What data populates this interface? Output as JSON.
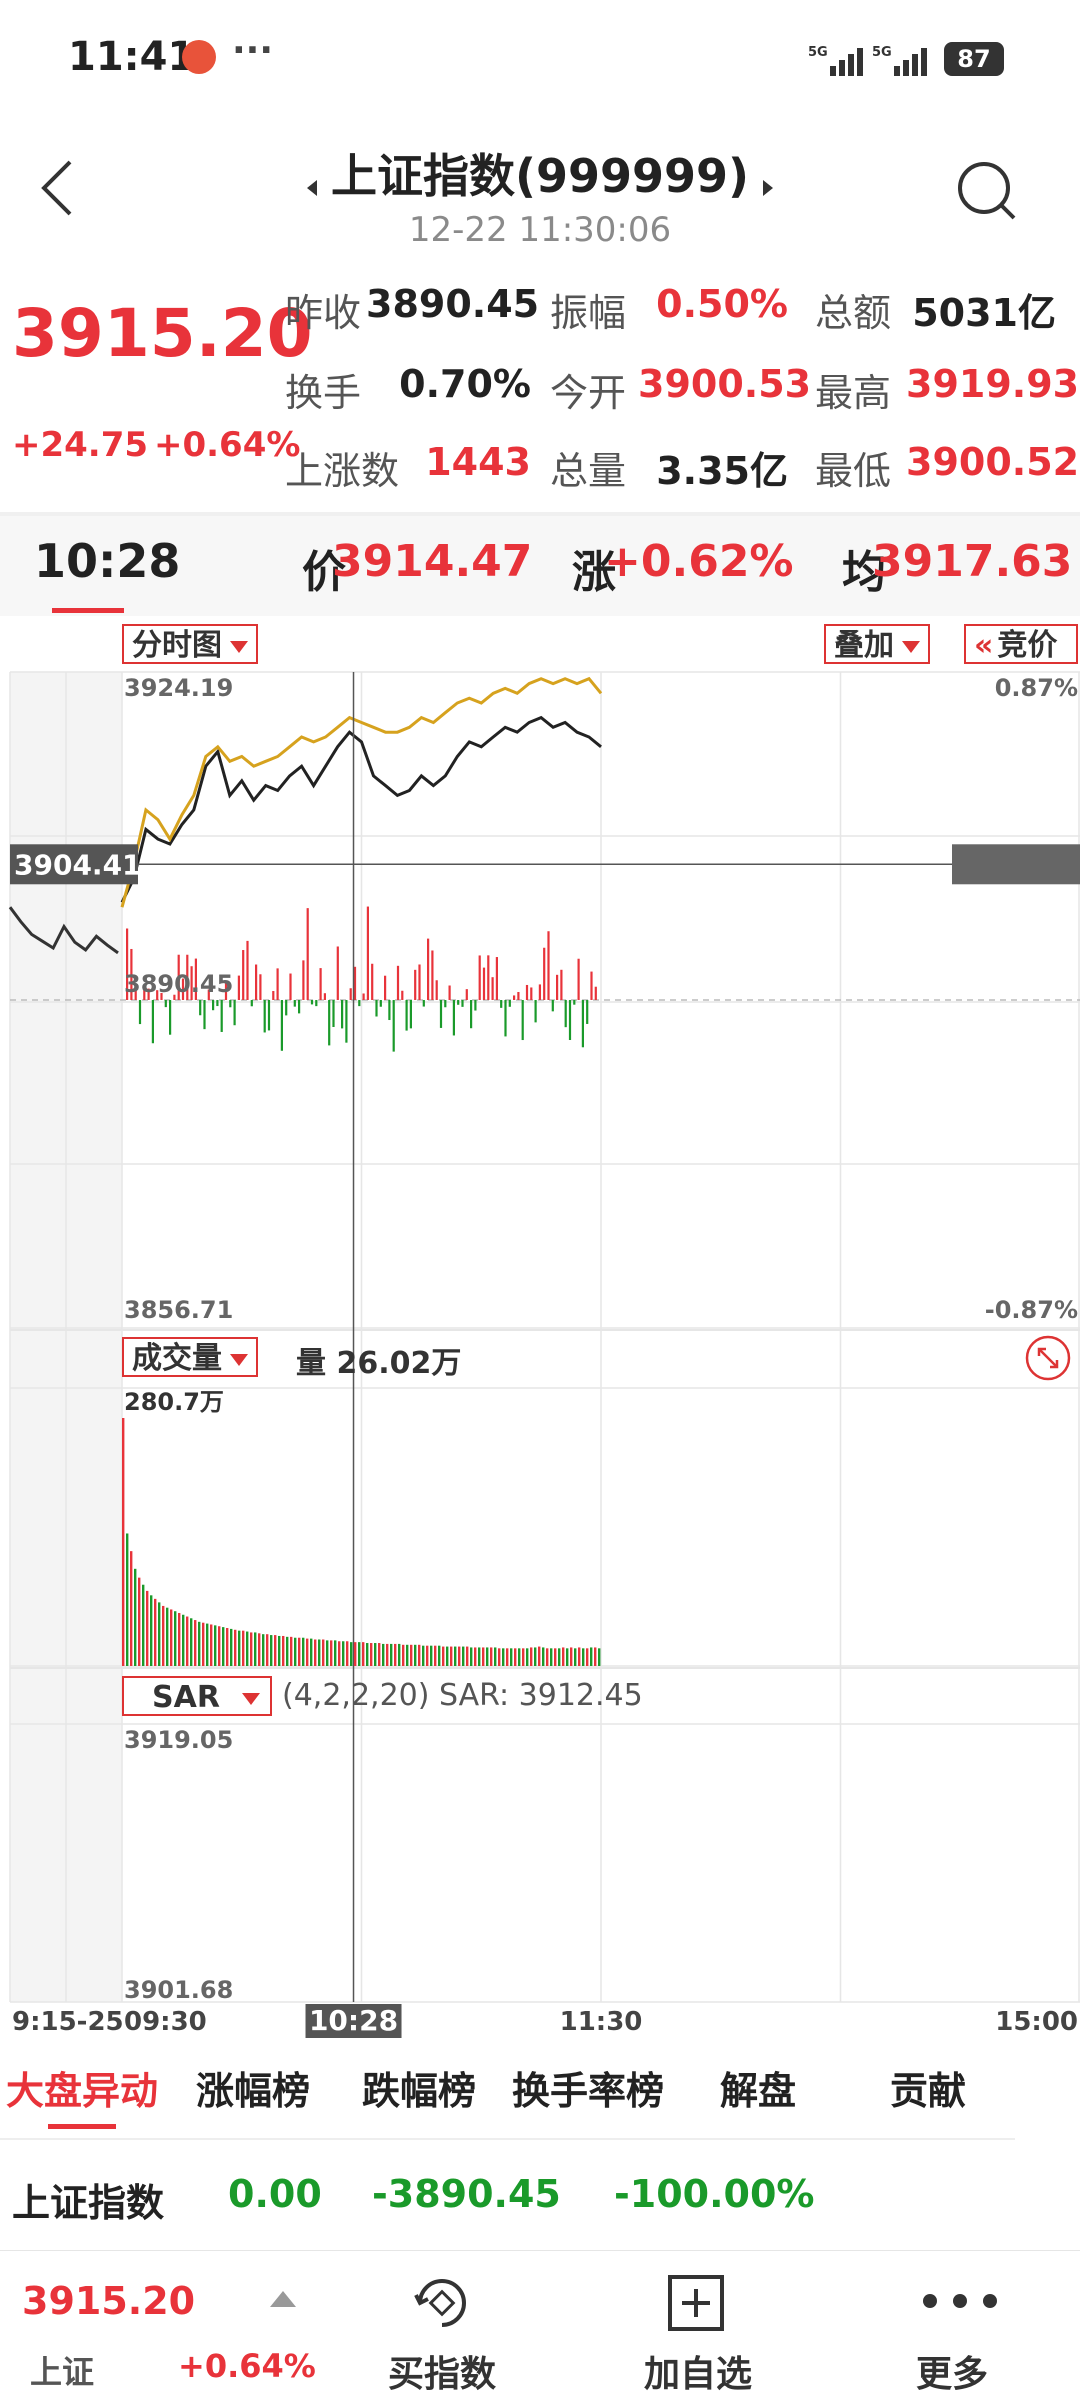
{
  "status": {
    "time": "11:41",
    "dots": "···",
    "net1": "5G",
    "net2": "5G",
    "battery": "87"
  },
  "header": {
    "title": "上证指数(999999)",
    "datetime": "12-22 11:30:06"
  },
  "quote": {
    "price": "3915.20",
    "change": "+24.75",
    "change_pct": "+0.64%",
    "rows": [
      [
        {
          "label": "昨收",
          "value": "3890.45",
          "color": "dark"
        },
        {
          "label": "振幅",
          "value": "0.50%",
          "color": "red"
        },
        {
          "label": "总额",
          "value": "5031亿",
          "color": "dark"
        }
      ],
      [
        {
          "label": "换手",
          "value": "0.70%",
          "color": "dark"
        },
        {
          "label": "今开",
          "value": "3900.53",
          "color": "red"
        },
        {
          "label": "最高",
          "value": "3919.93",
          "color": "red"
        }
      ],
      [
        {
          "label": "上涨数",
          "value": "1443",
          "color": "red"
        },
        {
          "label": "总量",
          "value": "3.35亿",
          "color": "dark"
        },
        {
          "label": "最低",
          "value": "3900.52",
          "color": "red"
        }
      ]
    ]
  },
  "crosshair_bar": {
    "time": "10:28",
    "price_label": "价",
    "price": "3914.47",
    "change_label": "涨",
    "change": "+0.62%",
    "avg_label": "均",
    "avg": "3917.63"
  },
  "chart_controls": {
    "fenshi": "分时图",
    "overlay": "叠加",
    "bidding": "竞价",
    "volume_indicator": "成交量",
    "volume_text": "量 26.02万",
    "sar": "SAR",
    "sar_params": "(4,2,2,20) SAR: 3912.45"
  },
  "chart_data": [
    {
      "type": "line",
      "title": "",
      "y_top_label": "3924.19",
      "y_bottom_label": "3856.71",
      "pct_top_label": "0.87%",
      "pct_bottom_label": "-0.87%",
      "prev_close_label": "3890.45",
      "crosshair_value_label": "3904.41",
      "ylim": [
        3856.71,
        3924.19
      ],
      "xlim_minutes": [
        0,
        240
      ],
      "x_ticks": [
        "9:15-25",
        "09:30",
        "10:28",
        "11:30",
        "15:00"
      ],
      "pre_market": [
        3900.0,
        3898.5,
        3897.2,
        3896.5,
        3895.8,
        3898.0,
        3896.4,
        3895.6,
        3897.0,
        3896.1,
        3895.3
      ],
      "series": [
        {
          "color": "#222222",
          "x": [
            0,
            3,
            6,
            9,
            12,
            15,
            18,
            21,
            24,
            27,
            30,
            33,
            36,
            39,
            42,
            45,
            48,
            51,
            54,
            57,
            60,
            63,
            66,
            69,
            72,
            75,
            78,
            81,
            84,
            87,
            90,
            93,
            96,
            99,
            102,
            105,
            108,
            111,
            114,
            117,
            120
          ],
          "values": [
            3900.5,
            3903.0,
            3908.0,
            3907.0,
            3906.5,
            3908.5,
            3910.0,
            3914.5,
            3916.0,
            3911.5,
            3913.0,
            3911.0,
            3912.5,
            3912.0,
            3913.5,
            3914.5,
            3912.5,
            3914.5,
            3916.5,
            3918.0,
            3917.0,
            3913.5,
            3912.5,
            3911.5,
            3912.0,
            3913.5,
            3912.5,
            3913.5,
            3915.5,
            3917.0,
            3916.5,
            3917.5,
            3918.5,
            3918.0,
            3919.0,
            3919.5,
            3918.5,
            3919.0,
            3918.0,
            3917.5,
            3916.5
          ]
        },
        {
          "color": "#d6a21e",
          "x": [
            0,
            3,
            6,
            9,
            12,
            15,
            18,
            21,
            24,
            27,
            30,
            33,
            36,
            39,
            42,
            45,
            48,
            51,
            54,
            57,
            60,
            63,
            66,
            69,
            72,
            75,
            78,
            81,
            84,
            87,
            90,
            93,
            96,
            99,
            102,
            105,
            108,
            111,
            114,
            117,
            120
          ],
          "values": [
            3900.0,
            3904.5,
            3910.0,
            3909.0,
            3907.0,
            3909.5,
            3911.5,
            3915.5,
            3916.5,
            3915.0,
            3915.5,
            3914.5,
            3915.0,
            3915.5,
            3916.5,
            3917.5,
            3917.0,
            3917.5,
            3918.5,
            3919.5,
            3919.0,
            3918.5,
            3918.0,
            3918.0,
            3918.5,
            3919.5,
            3919.0,
            3920.0,
            3921.0,
            3921.5,
            3921.0,
            3922.0,
            3922.5,
            3922.0,
            3923.0,
            3923.5,
            3923.0,
            3923.5,
            3923.0,
            3923.5,
            3922.0
          ]
        }
      ]
    },
    {
      "type": "bar",
      "title": "",
      "y_top_label": "280.7万",
      "values": [
        280.7,
        150,
        130,
        110,
        100,
        92,
        85,
        80,
        76,
        72,
        68,
        66,
        64,
        62,
        60,
        58,
        56,
        54,
        52,
        50,
        49,
        48,
        47,
        46,
        45,
        44,
        43,
        42,
        41,
        40,
        40,
        39,
        38,
        38,
        37,
        36,
        36,
        35,
        35,
        34,
        34,
        33,
        33,
        32,
        32,
        32,
        31,
        31,
        30,
        30,
        30,
        29,
        29,
        29,
        28,
        28,
        28,
        27,
        27,
        27,
        27,
        26,
        26,
        26,
        26,
        25,
        25,
        25,
        25,
        25,
        24,
        24,
        24,
        24,
        24,
        23,
        23,
        23,
        23,
        23,
        22,
        22,
        22,
        22,
        22,
        22,
        22,
        21,
        21,
        21,
        21,
        21,
        21,
        21,
        20,
        20,
        20,
        20,
        20,
        20,
        20,
        20,
        21,
        21,
        22,
        21,
        20,
        20,
        20,
        20,
        21,
        20,
        21,
        20,
        21,
        20,
        20,
        21,
        21,
        20
      ]
    },
    {
      "type": "line",
      "title": "",
      "y_top_label": "3919.05",
      "y_bottom_label": "3901.68"
    }
  ],
  "tabs": [
    {
      "label": "大盘异动",
      "active": true
    },
    {
      "label": "涨幅榜",
      "active": false
    },
    {
      "label": "跌幅榜",
      "active": false
    },
    {
      "label": "换手率榜",
      "active": false
    },
    {
      "label": "解盘",
      "active": false
    },
    {
      "label": "贡献",
      "active": false
    }
  ],
  "list_row": {
    "name": "上证指数",
    "price": "0.00",
    "change": "-3890.45",
    "change_pct": "-100.00%"
  },
  "bottom_bar": {
    "mini_price": "3915.20",
    "mini_name": "上证",
    "mini_pct": "+0.64%",
    "buttons": [
      {
        "label": "买指数",
        "icon": "buy-index-icon"
      },
      {
        "label": "加自选",
        "icon": "add-favorite-icon"
      },
      {
        "label": "更多",
        "icon": "more-icon"
      }
    ]
  },
  "colors": {
    "up": "#e8333a",
    "down": "#1a9a2a",
    "avg": "#d6a21e",
    "price_line": "#222222"
  }
}
